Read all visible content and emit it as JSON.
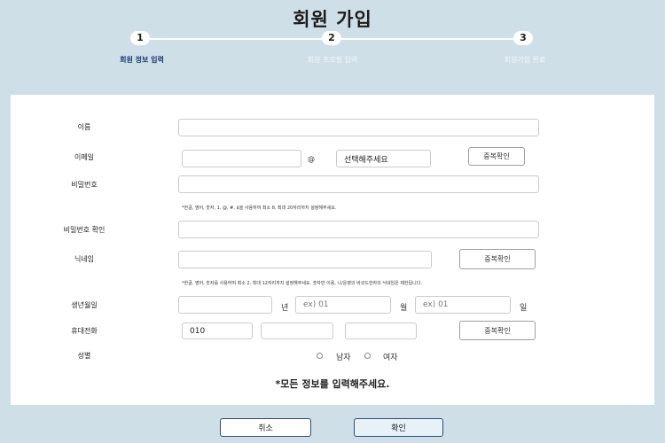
{
  "page_title": "회원 가입",
  "steps": [
    {
      "number": "1",
      "label": "회원 정보 입력",
      "active": true
    },
    {
      "number": "2",
      "label": "회원 프로필 입력",
      "active": false
    },
    {
      "number": "3",
      "label": "회원가입 완료",
      "active": false
    }
  ],
  "form": {
    "name_label": "이름",
    "email_label": "이메일",
    "email_at": "@",
    "email_domain_select": "선택해주세요",
    "email_check_button": "중복확인",
    "password_label": "비밀번호",
    "password_hint": "*한글, 영어, 숫자, 1, @, #, $을 사용하여 최소 8, 최대 20자리까지 설정해주세요.",
    "password_confirm_label": "비밀번호 확인",
    "nickname_label": "닉네임",
    "nickname_check_button": "중복확인",
    "nickname_hint": "*한글, 영어, 숫자를 사용하여 최소 2, 최대 12자리까지 설정해주세요. 숫자만 이용, 나/운영의 바코드한자의 닉네임은 제한됩니다.",
    "birth_label": "생년월일",
    "birth_year_unit": "년",
    "birth_month_placeholder": "ex) 01",
    "birth_month_unit": "월",
    "birth_day_placeholder": "ex) 01",
    "birth_day_unit": "일",
    "phone_label": "휴대전화",
    "phone_prefix": "010",
    "phone_check_button": "중복확인",
    "gender_label": "성별",
    "gender_options": [
      "남자",
      "여자"
    ]
  },
  "notice": "*모든 정보를 입력해주세요.",
  "buttons": {
    "cancel": "취소",
    "confirm": "확인"
  },
  "colors": {
    "background": "#cfdfe8",
    "active_step": "#1f3b6e",
    "confirm_button": "#e6f2f8"
  }
}
